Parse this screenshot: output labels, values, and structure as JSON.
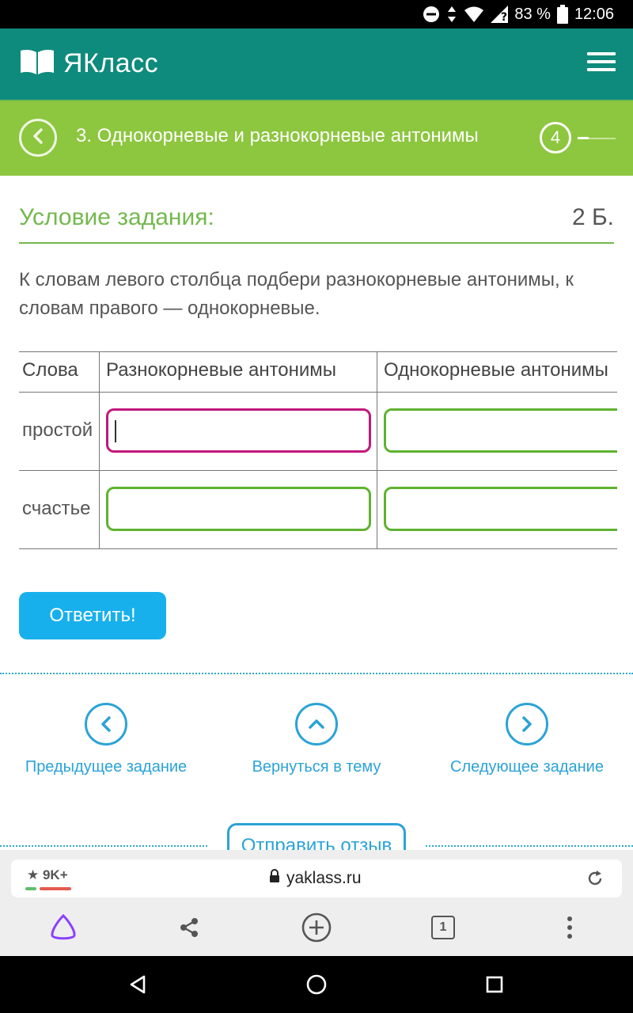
{
  "status_bar": {
    "battery": "83 %",
    "time": "12:06"
  },
  "header": {
    "logo_text": "ЯКласс"
  },
  "topic": {
    "title": "3. Однокорневые и разнокорневые антонимы",
    "step": "4"
  },
  "condition": {
    "title": "Условие задания:",
    "points": "2 Б.",
    "text": "К словам левого столбца подбери разнокорневые антонимы, к словам правого — однокорневые."
  },
  "table": {
    "headers": [
      "Слова",
      "Разнокорневые антонимы",
      "Однокорневые антонимы"
    ],
    "rows": [
      {
        "word": "простой",
        "answer1": "",
        "answer2": ""
      },
      {
        "word": "счастье",
        "answer1": "",
        "answer2": ""
      }
    ]
  },
  "answer_button": "Ответить!",
  "nav": {
    "prev": "Предыдущее задание",
    "up": "Вернуться в тему",
    "next": "Следующее задание"
  },
  "feedback_button": "Отправить отзыв",
  "browser": {
    "rating": "★ 9K+",
    "url": "yaklass.ru",
    "tab_count": "1"
  },
  "colors": {
    "header_teal": "#0e8b7c",
    "topic_green": "#8dc63f",
    "accent_green": "#74b84e",
    "button_blue": "#18b0ec",
    "link_blue": "#2ba3d6",
    "active_input": "#c2187d",
    "alice_purple": "#8a3ffc"
  }
}
